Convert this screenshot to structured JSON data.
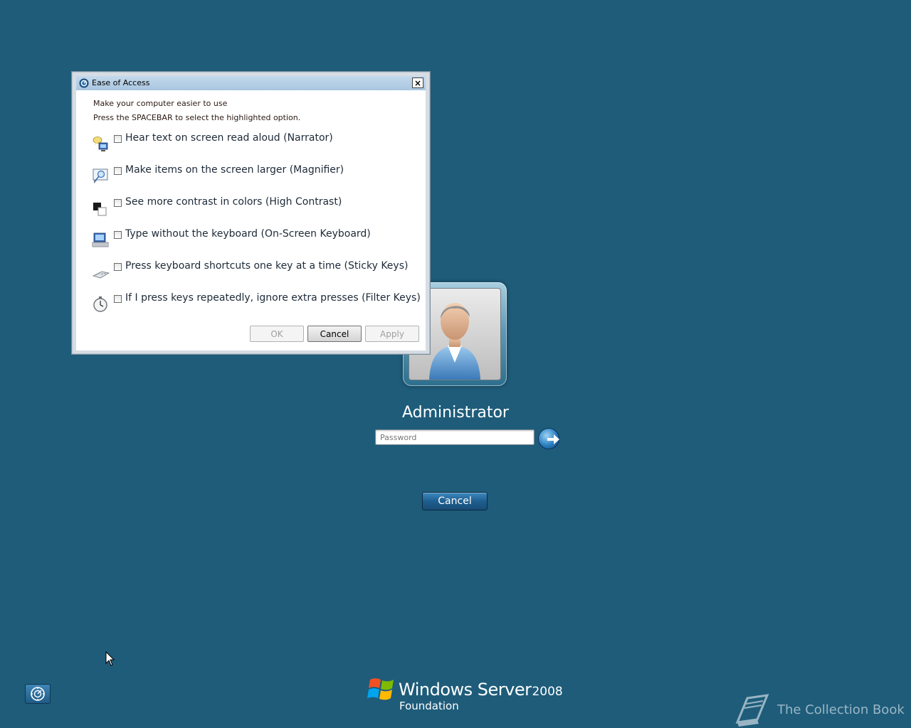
{
  "dialog": {
    "title": "Ease of Access",
    "close_label": "×",
    "instruction_1": "Make your computer easier to use",
    "instruction_2": "Press the SPACEBAR to select the highlighted option.",
    "options": [
      {
        "label": "Hear text on screen read aloud (Narrator)",
        "icon": "narrator-icon",
        "checked": false
      },
      {
        "label": "Make items on the screen larger (Magnifier)",
        "icon": "magnifier-icon",
        "checked": false
      },
      {
        "label": "See more contrast in colors (High Contrast)",
        "icon": "high-contrast-icon",
        "checked": false
      },
      {
        "label": "Type without the keyboard (On-Screen Keyboard)",
        "icon": "on-screen-keyboard-icon",
        "checked": false
      },
      {
        "label": "Press keyboard shortcuts one key at a time (Sticky Keys)",
        "icon": "sticky-keys-icon",
        "checked": false
      },
      {
        "label": "If I press keys repeatedly, ignore extra presses (Filter Keys)",
        "icon": "filter-keys-icon",
        "checked": false
      }
    ],
    "buttons": {
      "ok": "OK",
      "cancel": "Cancel",
      "apply": "Apply"
    }
  },
  "login": {
    "username": "Administrator",
    "password_placeholder": "Password",
    "cancel_label": "Cancel"
  },
  "brand": {
    "name": "Windows Server",
    "version": "2008",
    "edition": "Foundation"
  },
  "watermark": {
    "text": "The Collection Book"
  },
  "colors": {
    "background": "#1e5c7a",
    "title_bar": "#b5cfe6",
    "login_button": "#1f5f90"
  }
}
